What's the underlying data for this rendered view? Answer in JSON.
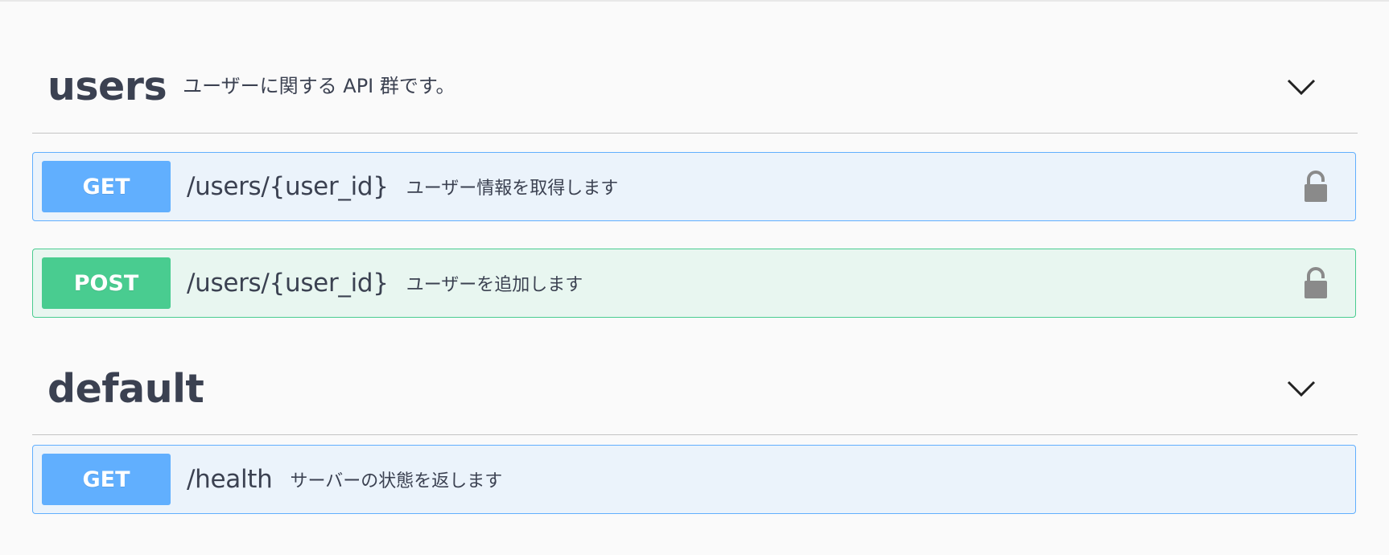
{
  "tags": [
    {
      "name": "users",
      "description": "ユーザーに関する API 群です。",
      "toggle_icon": "chevron-down-icon",
      "operations": [
        {
          "method": "GET",
          "path": "/users/{user_id}",
          "summary": "ユーザー情報を取得します",
          "locked": true
        },
        {
          "method": "POST",
          "path": "/users/{user_id}",
          "summary": "ユーザーを追加します",
          "locked": true
        }
      ]
    },
    {
      "name": "default",
      "description": "",
      "toggle_icon": "chevron-down-icon",
      "operations": [
        {
          "method": "GET",
          "path": "/health",
          "summary": "サーバーの状態を返します",
          "locked": false
        }
      ]
    }
  ],
  "colors": {
    "get_accent": "#61affe",
    "get_background": "#ebf3fb",
    "post_accent": "#49cc90",
    "post_background": "#e8f6f0",
    "text": "#3b4151"
  }
}
